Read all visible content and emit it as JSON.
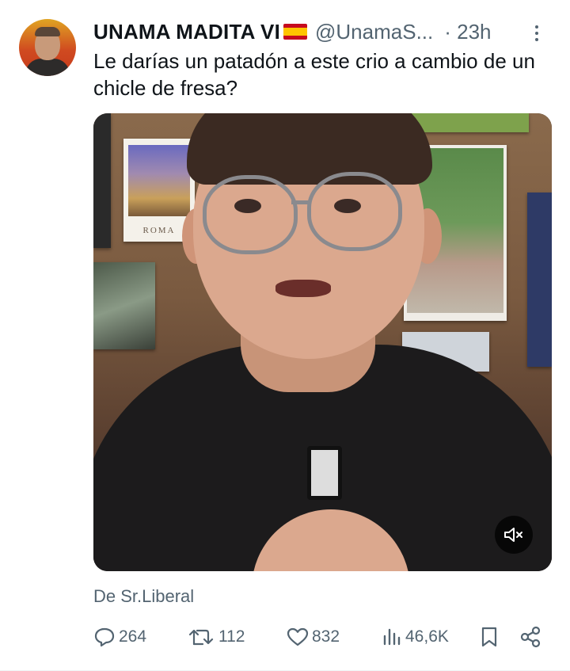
{
  "tweet": {
    "author": {
      "display_name": "UNAMA MADITA VI",
      "flag_icon": "spain-flag",
      "handle": "@UnamaS...",
      "time": "· 23h"
    },
    "text": "Le darías un patadón a este crio a cambio de un chicle de fresa?",
    "media": {
      "postcard_caption": "ROMA",
      "mute_icon": "speaker-muted-icon"
    },
    "source": "De Sr.Liberal",
    "actions": {
      "replies": "264",
      "retweets": "112",
      "likes": "832",
      "views": "46,6K"
    }
  },
  "colors": {
    "text_primary": "#0f1419",
    "text_secondary": "#536471",
    "divider": "#eff3f4"
  }
}
